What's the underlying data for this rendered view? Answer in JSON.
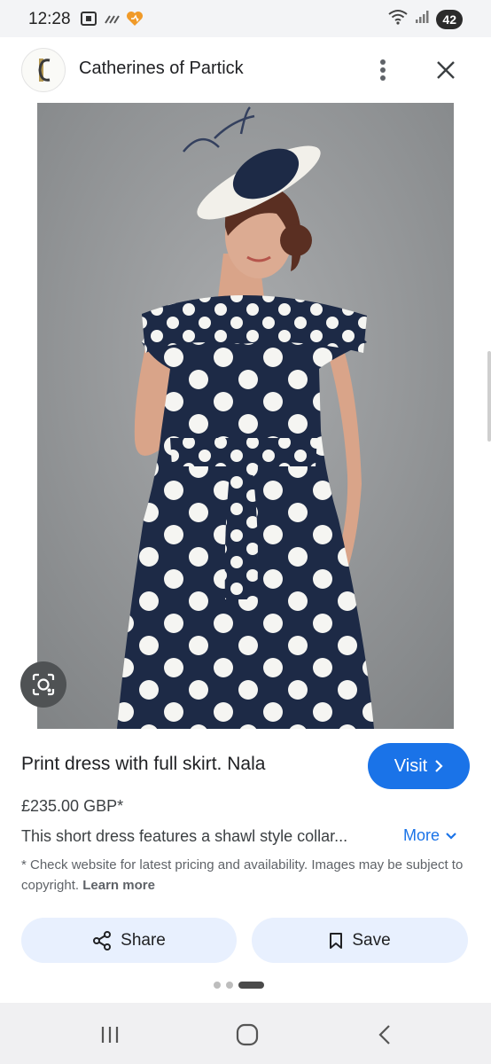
{
  "status_bar": {
    "time": "12:28",
    "battery": "42"
  },
  "header": {
    "site_name": "Catherines of Partick",
    "logo_letter": "C"
  },
  "product": {
    "title": "Print dress with full skirt. Nala",
    "price": "£235.00 GBP*",
    "description": "This short dress features a shawl style collar...",
    "more_label": "More",
    "visit_label": "Visit",
    "disclaimer": "* Check website for latest pricing and availability. Images may be subject to copyright.",
    "learn_more": "Learn more"
  },
  "actions": {
    "share_label": "Share",
    "save_label": "Save"
  },
  "carousel": {
    "page_count": 3,
    "active_index": 2
  },
  "icons": {
    "status_left": [
      "screenshot-icon",
      "signal-activity-icon",
      "heart-app-icon"
    ],
    "status_right": [
      "wifi-icon",
      "cell-signal-icon"
    ],
    "header": [
      "more-vert-icon",
      "close-icon"
    ],
    "lens": "lens-search-icon",
    "share": "share-icon",
    "save": "bookmark-icon",
    "nav": [
      "recent-apps-icon",
      "home-icon",
      "back-icon"
    ]
  },
  "colors": {
    "accent": "#1a73e8",
    "chip_bg": "#e8f0fe",
    "dress_navy": "#1d2a46"
  }
}
